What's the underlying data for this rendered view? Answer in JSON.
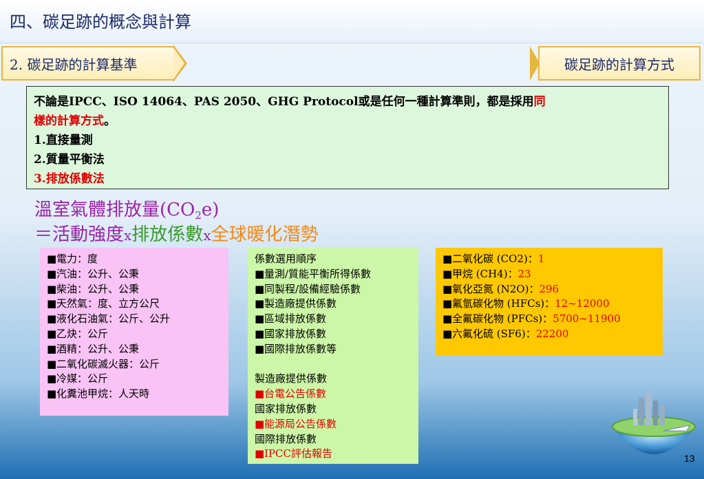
{
  "page_title": "四、碳足跡的概念與計算",
  "tabs": {
    "left_label": "2. 碳足跡的計算基準",
    "right_label": "碳足跡的計算方式"
  },
  "method_box": {
    "line1_black": "不論是IPCC、ISO 14064、PAS 2050、GHG Protocol或是任何一種計算準則，都是採用",
    "line1_red": "同",
    "line2_red": "樣的計算方式",
    "line2_black": "。",
    "item1": "1.直接量測",
    "item2": "2.質量平衡法",
    "item3": "3.排放係數法"
  },
  "formula": {
    "line1_text": "溫室氣體排放量(CO",
    "line1_sub": "2",
    "line1_end": "e)",
    "eq_prefix": "＝活動強度",
    "times": "x",
    "term2": "排放係數",
    "term3": "全球暖化潛勢"
  },
  "activity_units": [
    "電力：度",
    "汽油：公升、公秉",
    "柴油：公升、公秉",
    "天然氣：度、立方公尺",
    "液化石油氣：公斤、公升",
    "乙炔：公斤",
    "酒精：公升、公秉",
    "二氧化碳滅火器：公斤",
    "冷媒：公斤",
    "化糞池甲烷：人天時"
  ],
  "factor_panel": {
    "heading": "係數選用順序",
    "priority": [
      "量測/質能平衡所得係數",
      "同製程/設備經驗係數",
      "製造廠提供係數",
      "區域排放係數",
      "國家排放係數",
      "國際排放係數等"
    ],
    "sources": [
      {
        "category": "製造廠提供係數",
        "source": "台電公告係數"
      },
      {
        "category": "國家排放係數",
        "source": "能源局公告係數"
      },
      {
        "category": "國際排放係數",
        "source": "IPCC評估報告"
      }
    ]
  },
  "gwp_panel": [
    {
      "gas": "二氧化碳 (CO2)：",
      "value": "1"
    },
    {
      "gas": "甲烷 (CH4)：",
      "value": "23"
    },
    {
      "gas": "氧化亞氮 (N2O)：",
      "value": "296"
    },
    {
      "gas": "氟氫碳化物 (HFCs)：",
      "value": "12~12000"
    },
    {
      "gas": "全氟碳化物 (PFCs)：",
      "value": "5700~11900"
    },
    {
      "gas": "六氟化硫 (SF6)：",
      "value": "22200"
    }
  ],
  "bullet_glyph": "■",
  "page_number": "13",
  "colors": {
    "title": "#1b2a6b",
    "red": "#e00000",
    "purple": "#9b22a8",
    "green": "#3a9a2c",
    "orange": "#f08a18",
    "pink_panel": "#f9c3f5",
    "green_panel": "#cdf7a8",
    "yellow_panel": "#ffc800",
    "method_box": "#ddf7dd"
  },
  "decorations": [
    "globe-city-icon"
  ]
}
